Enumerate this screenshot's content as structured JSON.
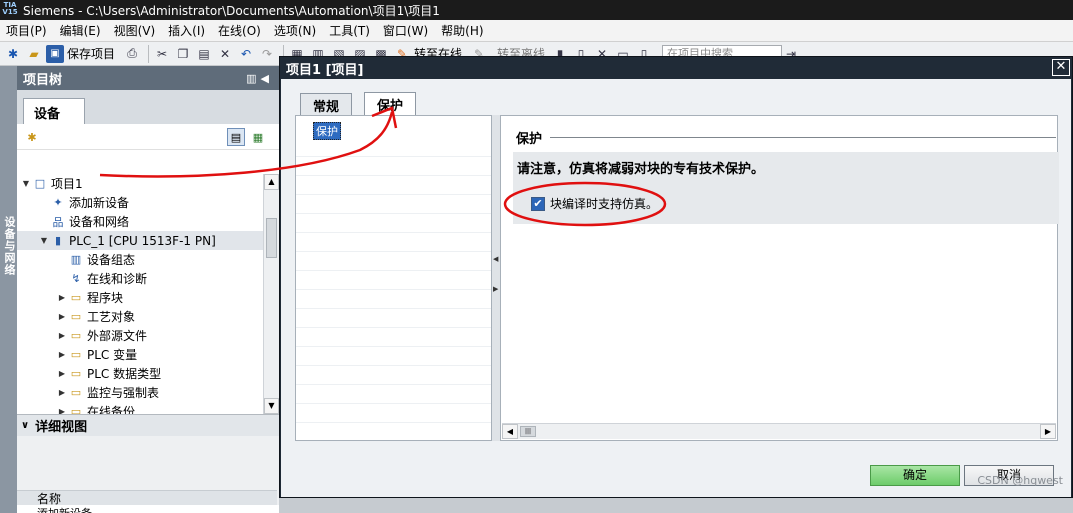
{
  "window": {
    "logo": "TIA V15",
    "app_title": "Siemens  -  C:\\Users\\Administrator\\Documents\\Automation\\项目1\\项目1"
  },
  "menu": [
    "项目(P)",
    "编辑(E)",
    "视图(V)",
    "插入(I)",
    "在线(O)",
    "选项(N)",
    "工具(T)",
    "窗口(W)",
    "帮助(H)"
  ],
  "toolbar": {
    "save_project_label": "保存项目",
    "go_online_label": "转至在线",
    "go_offline_label": "转至离线",
    "search_placeholder": "在项目中搜索"
  },
  "left_vertical_tab": "设备与网络",
  "project_tree": {
    "title": "项目树",
    "devices_tab": "设备",
    "items": [
      {
        "label": "项目1",
        "indent": 0,
        "arrow": "▼",
        "icon": "project-icon",
        "glyph": "□"
      },
      {
        "label": "添加新设备",
        "indent": 1,
        "arrow": "",
        "icon": "add-device-icon",
        "glyph": "✦"
      },
      {
        "label": "设备和网络",
        "indent": 1,
        "arrow": "",
        "icon": "network-icon",
        "glyph": "品"
      },
      {
        "label": "PLC_1 [CPU 1513F-1 PN]",
        "indent": 1,
        "arrow": "▼",
        "icon": "plc-icon",
        "glyph": "▮",
        "selected": true
      },
      {
        "label": "设备组态",
        "indent": 2,
        "arrow": "",
        "icon": "device-config-icon",
        "glyph": "▥"
      },
      {
        "label": "在线和诊断",
        "indent": 2,
        "arrow": "",
        "icon": "diagnostics-icon",
        "glyph": "↯"
      },
      {
        "label": "程序块",
        "indent": 2,
        "arrow": "▶",
        "icon": "folder-icon",
        "glyph": "▭"
      },
      {
        "label": "工艺对象",
        "indent": 2,
        "arrow": "▶",
        "icon": "folder-icon",
        "glyph": "▭"
      },
      {
        "label": "外部源文件",
        "indent": 2,
        "arrow": "▶",
        "icon": "folder-icon",
        "glyph": "▭"
      },
      {
        "label": "PLC 变量",
        "indent": 2,
        "arrow": "▶",
        "icon": "folder-icon",
        "glyph": "▭"
      },
      {
        "label": "PLC 数据类型",
        "indent": 2,
        "arrow": "▶",
        "icon": "folder-icon",
        "glyph": "▭"
      },
      {
        "label": "监控与强制表",
        "indent": 2,
        "arrow": "▶",
        "icon": "folder-icon",
        "glyph": "▭"
      },
      {
        "label": "在线备份",
        "indent": 2,
        "arrow": "▶",
        "icon": "folder-icon",
        "glyph": "▭"
      }
    ]
  },
  "detail_view": {
    "title": "详细视图",
    "column_name": "名称",
    "cut_row": "添加新设备"
  },
  "dialog": {
    "title": "项目1 [项目]",
    "tabs": [
      "常规",
      "保护"
    ],
    "active_tab": "保护",
    "nav_item": "保护",
    "section_title": "保护",
    "note": "请注意，仿真将减弱对块的专有技术保护。",
    "checkbox_label": "块编译时支持仿真。",
    "checkbox_checked": true,
    "ok_label": "确定",
    "cancel_label": "取消"
  },
  "watermark": "CSDN @hqwest",
  "colors": {
    "title_bar": "#1b1b1b",
    "panel_header": "#5f6c7a",
    "dialog_frame": "#1f2a36",
    "ok_button": "#6dcc6a",
    "annotation_red": "#e01010"
  }
}
